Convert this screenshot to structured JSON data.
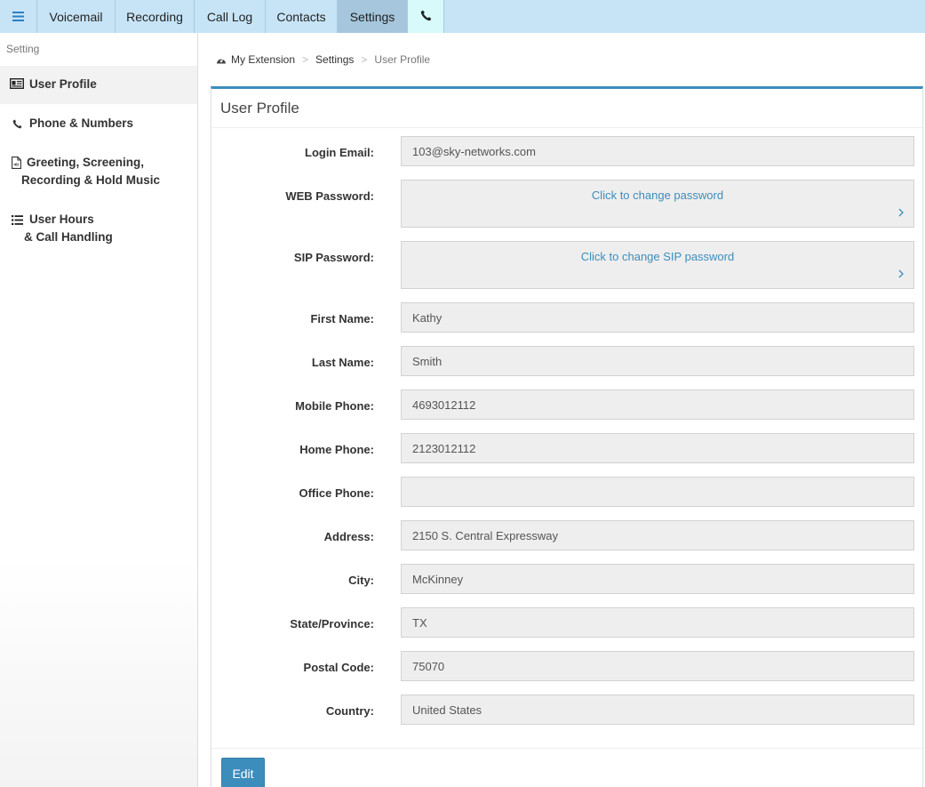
{
  "topnav": {
    "menu_icon": "hamburger-icon",
    "tabs": [
      {
        "label": "Voicemail"
      },
      {
        "label": "Recording"
      },
      {
        "label": "Call Log"
      },
      {
        "label": "Contacts"
      },
      {
        "label": "Settings",
        "active": true
      }
    ],
    "phone_icon": "phone-icon",
    "active_color": "#a5c6dd",
    "bar_color": "#c7e4f7"
  },
  "sidebar": {
    "heading": "Setting",
    "items": [
      {
        "label": "User Profile",
        "icon": "id-card-icon",
        "active": true
      },
      {
        "label": "Phone & Numbers",
        "icon": "phone-icon"
      },
      {
        "label_line1": "Greeting, Screening,",
        "label_line2": "Recording & Hold Music",
        "icon": "audio-file-icon"
      },
      {
        "label_line1": "User Hours",
        "label_line2": "& Call Handling",
        "icon": "list-icon"
      }
    ]
  },
  "breadcrumb": {
    "home_icon": "dashboard-icon",
    "items": [
      "My Extension",
      "Settings",
      "User Profile"
    ],
    "separator": ">"
  },
  "panel": {
    "title": "User Profile",
    "accent_color": "#3c8dbc",
    "fields": {
      "login_email": {
        "label": "Login Email:",
        "value": "103@sky-networks.com"
      },
      "web_password": {
        "label": "WEB Password:",
        "link": "Click to change password"
      },
      "sip_password": {
        "label": "SIP Password:",
        "link": "Click to change SIP password"
      },
      "first_name": {
        "label": "First Name:",
        "value": "Kathy"
      },
      "last_name": {
        "label": "Last Name:",
        "value": "Smith"
      },
      "mobile_phone": {
        "label": "Mobile Phone:",
        "value": "4693012112"
      },
      "home_phone": {
        "label": "Home Phone:",
        "value": "2123012112"
      },
      "office_phone": {
        "label": "Office Phone:",
        "value": ""
      },
      "address": {
        "label": "Address:",
        "value": "2150 S. Central Expressway"
      },
      "city": {
        "label": "City:",
        "value": "McKinney"
      },
      "state": {
        "label": "State/Province:",
        "value": "TX"
      },
      "postal_code": {
        "label": "Postal Code:",
        "value": "75070"
      },
      "country": {
        "label": "Country:",
        "value": "United States"
      }
    },
    "edit_label": "Edit"
  }
}
